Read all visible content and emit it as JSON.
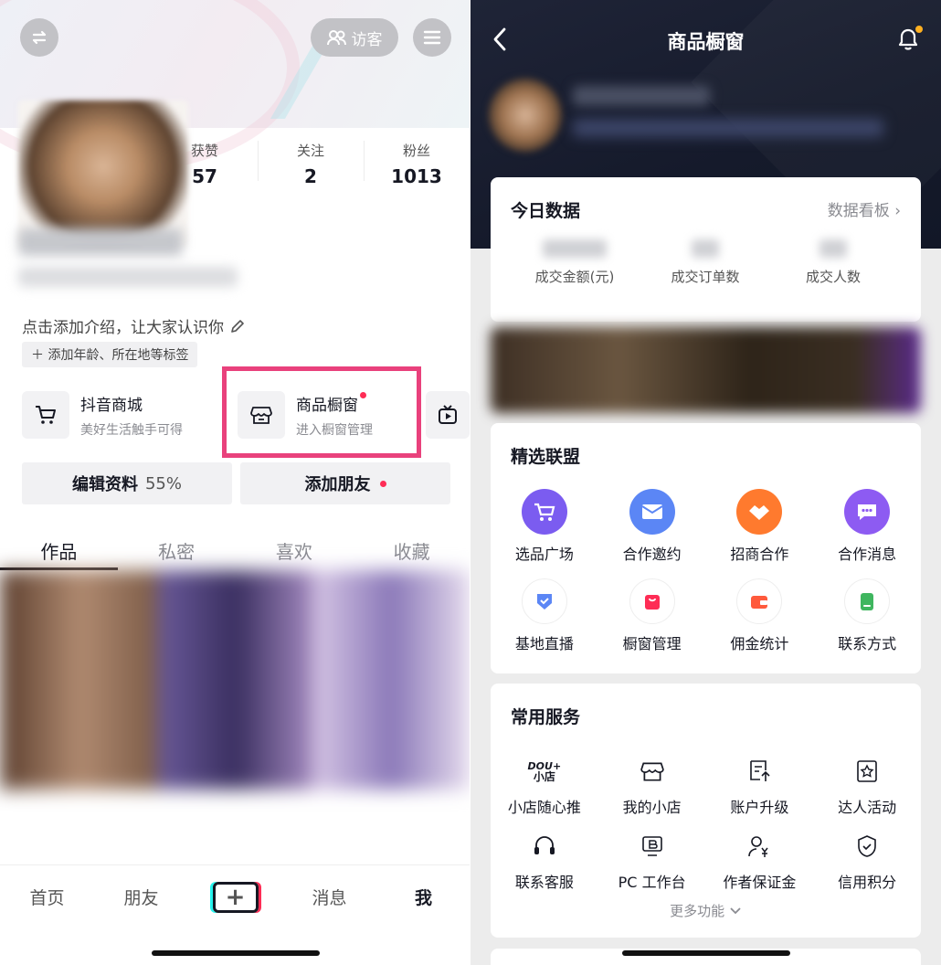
{
  "left": {
    "visitor_label": "访客",
    "stats": [
      {
        "label": "获赞",
        "value": "57"
      },
      {
        "label": "关注",
        "value": "2"
      },
      {
        "label": "粉丝",
        "value": "1013"
      }
    ],
    "intro": "点击添加介绍，让大家认识你",
    "tag_button": "＋ 添加年龄、所在地等标签",
    "services": [
      {
        "title": "抖音商城",
        "subtitle": "美好生活触手可得"
      },
      {
        "title": "商品橱窗",
        "subtitle": "进入橱窗管理"
      }
    ],
    "edit_profile": "编辑资料",
    "edit_percent": "55%",
    "add_friend": "添加朋友",
    "tabs": [
      "作品",
      "私密",
      "喜欢",
      "收藏"
    ],
    "nav": [
      "首页",
      "朋友",
      "+",
      "消息",
      "我"
    ]
  },
  "right": {
    "title": "商品橱窗",
    "today": {
      "title": "今日数据",
      "link": "数据看板 ›",
      "stats": [
        "成交金额(元)",
        "成交订单数",
        "成交人数"
      ]
    },
    "alliance": {
      "title": "精选联盟",
      "items": [
        "选品广场",
        "合作邀约",
        "招商合作",
        "合作消息",
        "基地直播",
        "橱窗管理",
        "佣金统计",
        "联系方式"
      ]
    },
    "services": {
      "title": "常用服务",
      "douplus_top": "DOU+",
      "douplus_bottom": "小店",
      "items": [
        "小店随心推",
        "我的小店",
        "账户升级",
        "达人活动",
        "联系客服",
        "PC 工作台",
        "作者保证金",
        "信用积分"
      ],
      "more": "更多功能"
    }
  },
  "colors": {
    "accent": "#fe2c55",
    "highlight": "#e9417c",
    "purple": "#7b5cf0",
    "blue": "#5b86f5",
    "orange": "#ff7a2e"
  }
}
